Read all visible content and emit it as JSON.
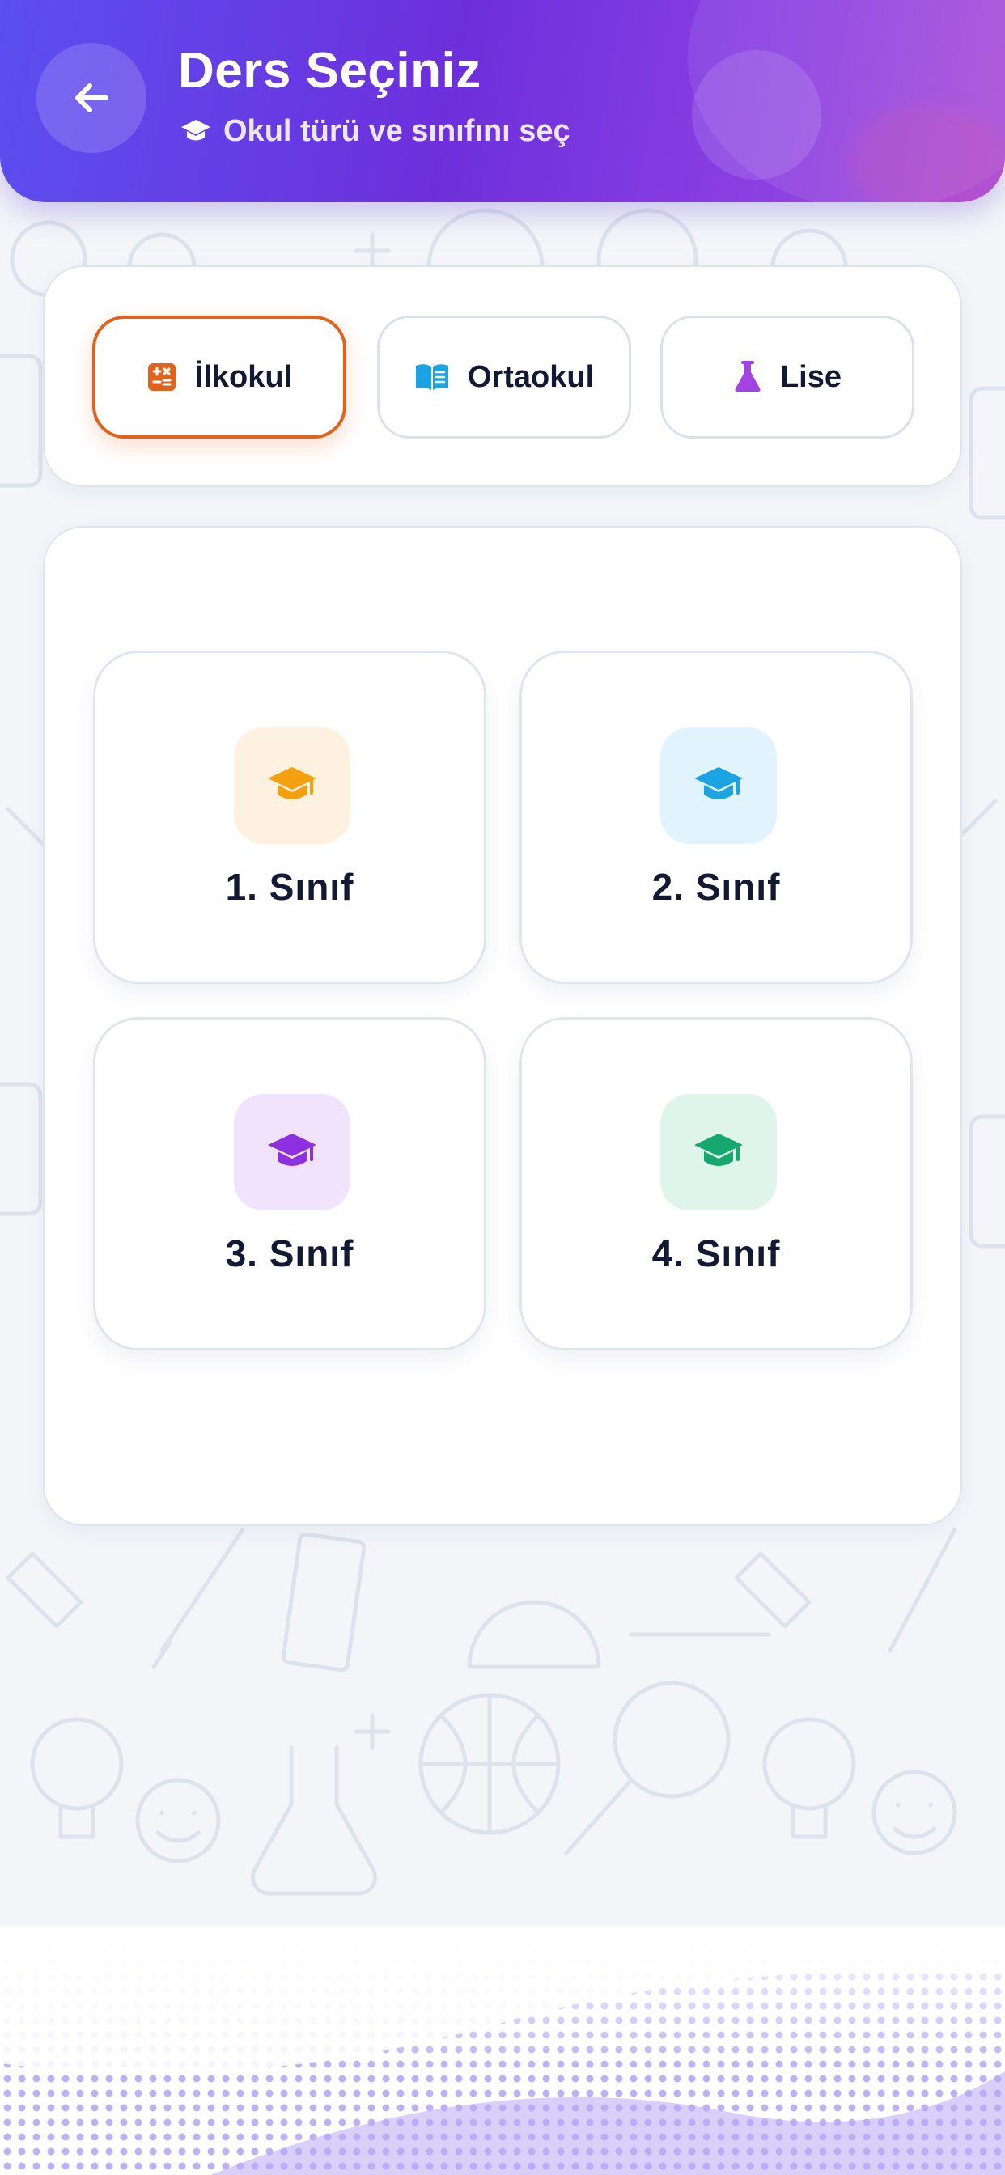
{
  "header": {
    "title": "Ders Seçiniz",
    "subtitle": "Okul türü ve sınıfını seç",
    "back_icon": "arrow-left-icon",
    "subtitle_icon": "graduation-cap-icon"
  },
  "school_types": [
    {
      "label": "İlkokul",
      "icon": "calculator-icon",
      "color": "#e2621b",
      "selected": true
    },
    {
      "label": "Ortaokul",
      "icon": "book-open-icon",
      "color": "#1ba3e2",
      "selected": false
    },
    {
      "label": "Lise",
      "icon": "flask-icon",
      "color": "#a444e0",
      "selected": false
    }
  ],
  "grades": [
    {
      "label": "1. Sınıf",
      "icon": "graduation-cap-icon",
      "color": "#f5a00f",
      "bg": "#fff1df"
    },
    {
      "label": "2. Sınıf",
      "icon": "graduation-cap-icon",
      "color": "#1ba3e2",
      "bg": "#e1f3fd"
    },
    {
      "label": "3. Sınıf",
      "icon": "graduation-cap-icon",
      "color": "#8e2fe0",
      "bg": "#f1e3fb"
    },
    {
      "label": "4. Sınıf",
      "icon": "graduation-cap-icon",
      "color": "#16a86e",
      "bg": "#dff5ec"
    }
  ],
  "colors": {
    "header_gradient_start": "#5b4ff0",
    "header_gradient_end": "#a94fd9",
    "selected_border": "#e2621b",
    "text_primary": "#121a33",
    "page_background": "#f3f5f9"
  }
}
